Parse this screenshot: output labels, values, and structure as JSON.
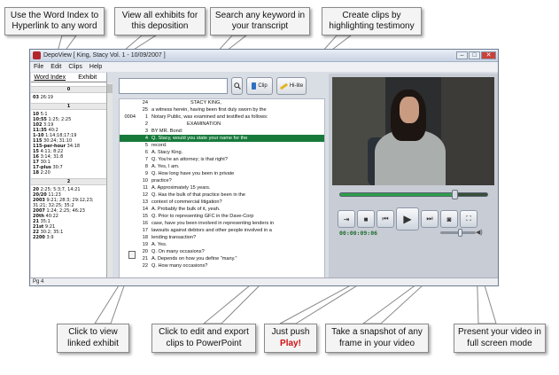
{
  "callouts": {
    "word_index": "Use the Word Index to\nHyperlink to any word",
    "exhibits": "View all exhibits for\nthis deposition",
    "search": "Search any keyword in\nyour transcript",
    "create_clips": "Create clips by\nhighlighting testimony",
    "linked_exhibit": "Click to view\nlinked exhibit",
    "edit_clips": "Click to edit and export\nclips to PowerPoint",
    "just_push": "Just push",
    "play": "Play!",
    "snapshot": "Take a snapshot of any\nframe in your video",
    "fullscreen": "Present your video in\nfull screen mode"
  },
  "window": {
    "title_app": "DepoView",
    "title_doc": "[ King, Stacy Vol. 1 - 10/09/2007 ]",
    "min": "–",
    "max": "□",
    "close": "✕"
  },
  "menu": {
    "file": "File",
    "edit": "Edit",
    "clips": "Clips",
    "help": "Help"
  },
  "tabs": {
    "word_index": "Word Index",
    "exhibits": "Exhibit"
  },
  "word_index": {
    "s0": "0",
    "s0_items": [
      {
        "w": "03",
        "r": "26:19"
      }
    ],
    "s1": "1",
    "s1_items": [
      {
        "w": "10",
        "r": "5:1"
      },
      {
        "w": "10:55",
        "r": "1:25; 2:25"
      },
      {
        "w": "102",
        "r": "3:19"
      },
      {
        "w": "11:35",
        "r": "40:2"
      },
      {
        "w": "1-10",
        "r": "1:14;18;17;19"
      },
      {
        "w": "115",
        "r": "30:24; 31:10"
      },
      {
        "w": "115-per-hour",
        "r": "34:18"
      },
      {
        "w": "15",
        "r": "4:11; 8:22"
      },
      {
        "w": "16",
        "r": "3:14; 31:8"
      },
      {
        "w": "17",
        "r": "30:1"
      },
      {
        "w": "17-plus",
        "r": "30:7"
      },
      {
        "w": "18",
        "r": "2:20"
      }
    ],
    "s2": "2",
    "s2_items": [
      {
        "w": "20",
        "r": "2:25; 5:3;7, 14:21"
      },
      {
        "w": "20/20",
        "r": "11:23"
      },
      {
        "w": "2003",
        "r": "9:21; 28:3; 29:12,23; 31:21; 32:25; 35:2"
      },
      {
        "w": "2007",
        "r": "1:24; 2:25; 46:23"
      },
      {
        "w": "20th",
        "r": "40:22"
      },
      {
        "w": "21",
        "r": "35:1"
      },
      {
        "w": "21st",
        "r": "9:21"
      },
      {
        "w": "22",
        "r": "30:2; 35:1"
      },
      {
        "w": "2200",
        "r": "3:9"
      }
    ]
  },
  "toolbar": {
    "search_placeholder": "",
    "clip_label": "Clip",
    "hilite_label": "Hi-lite"
  },
  "transcript": [
    {
      "page": "",
      "num": "24",
      "text": "STACY KING,",
      "hl": false
    },
    {
      "page": "",
      "num": "25",
      "text": "a witness herein, having been first duly sworn by the",
      "hl": false
    },
    {
      "page": "0004",
      "num": "1",
      "text": "Notary Public, was examined and testified as follows:",
      "hl": false
    },
    {
      "page": "",
      "num": "2",
      "text": "EXAMINATION",
      "hl": false
    },
    {
      "page": "",
      "num": "3",
      "text": "BY MR. Bond:",
      "hl": false
    },
    {
      "page": "",
      "num": "4",
      "text": "Q.   Stacy, would you state your name for the",
      "hl": true
    },
    {
      "page": "",
      "num": "5",
      "text": "record.",
      "hl": false
    },
    {
      "page": "",
      "num": "6",
      "text": "A.   Stacy King.",
      "hl": false
    },
    {
      "page": "",
      "num": "7",
      "text": "Q.   You're an attorney; is that right?",
      "hl": false
    },
    {
      "page": "",
      "num": "8",
      "text": "A.   Yes, I am.",
      "hl": false
    },
    {
      "page": "",
      "num": "9",
      "text": "Q.   How long have you been in private",
      "hl": false
    },
    {
      "page": "",
      "num": "10",
      "text": "practice?",
      "hl": false
    },
    {
      "page": "",
      "num": "11",
      "text": "A.   Approximately 15 years.",
      "hl": false
    },
    {
      "page": "",
      "num": "12",
      "text": "Q.   Has the bulk of that practice been in the",
      "hl": false
    },
    {
      "page": "",
      "num": "13",
      "text": "context of commercial litigation?",
      "hl": false
    },
    {
      "page": "",
      "num": "14",
      "text": "A.   Probably the bulk of it, yeah.",
      "hl": false
    },
    {
      "page": "",
      "num": "15",
      "text": "Q.   Prior to representing GFC in the Dave-Corp",
      "hl": false
    },
    {
      "page": "",
      "num": "16",
      "text": "case, have you been involved in representing lenders in",
      "hl": false
    },
    {
      "page": "",
      "num": "17",
      "text": "lawsuits against debtors and other people involved in a",
      "hl": false
    },
    {
      "page": "",
      "num": "18",
      "text": "lending transaction?",
      "hl": false
    },
    {
      "page": "",
      "num": "19",
      "text": "A.   Yes.",
      "hl": false
    },
    {
      "page": "",
      "num": "20",
      "text": "Q.   On many occasions?",
      "hl": false
    },
    {
      "page": "",
      "num": "21",
      "text": "A.   Depends on how you define \"many.\"",
      "hl": false
    },
    {
      "page": "",
      "num": "22",
      "text": "Q.   How many occasions?",
      "hl": false
    }
  ],
  "player": {
    "time": "00:00:09:06",
    "progress": 0.78,
    "volume": 0.55,
    "accent": "#2fa04a"
  },
  "status": {
    "page": "Pg 4"
  },
  "icons": {
    "search": "search-icon",
    "exhibit": "exhibit-link-icon",
    "edit_clips": "clip-edit-icon",
    "stop": "stop-icon",
    "prev": "skip-back-icon",
    "play": "play-icon",
    "next": "skip-forward-icon",
    "snapshot": "camera-icon",
    "fullscreen": "fullscreen-icon"
  }
}
